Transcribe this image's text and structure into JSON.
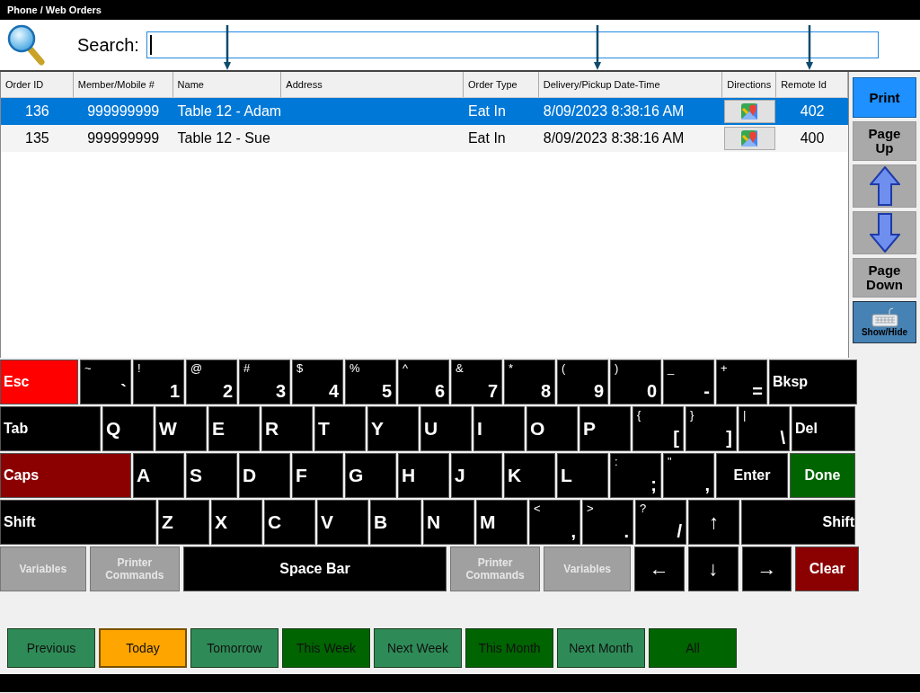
{
  "window": {
    "title": "Phone / Web Orders"
  },
  "search": {
    "label": "Search:"
  },
  "table": {
    "columns": [
      "Order ID",
      "Member/Mobile #",
      "Name",
      "Address",
      "Order Type",
      "Delivery/Pickup Date-Time",
      "Directions",
      "Remote Id"
    ],
    "rows": [
      {
        "selected": true,
        "order_id": "136",
        "member": "999999999",
        "name": "Table 12 - Adam",
        "order_type": "Eat In",
        "date_time": "8/09/2023 8:38:16 AM",
        "remote_id": "402"
      },
      {
        "selected": false,
        "order_id": "135",
        "member": "999999999",
        "name": "Table 12 - Sue",
        "order_type": "Eat In",
        "date_time": "8/09/2023 8:38:16 AM",
        "remote_id": "400"
      }
    ]
  },
  "side_panel": [
    {
      "kind": "primary",
      "label": "Print"
    },
    {
      "kind": "text",
      "label": "Page Up"
    },
    {
      "kind": "up"
    },
    {
      "kind": "down"
    },
    {
      "kind": "text",
      "label": "Page Down"
    },
    {
      "kind": "keyboard",
      "label": "Show/Hide"
    }
  ],
  "keyboard": [
    [
      {
        "kind": "label",
        "label": "Esc",
        "color": "#ff0000"
      },
      {
        "kind": "dual",
        "shift": "~",
        "base": "`"
      },
      {
        "kind": "dual",
        "shift": "!",
        "base": "1"
      },
      {
        "kind": "dual",
        "shift": "@",
        "base": "2"
      },
      {
        "kind": "dual",
        "shift": "#",
        "base": "3"
      },
      {
        "kind": "dual",
        "shift": "$",
        "base": "4"
      },
      {
        "kind": "dual",
        "shift": "%",
        "base": "5"
      },
      {
        "kind": "dual",
        "shift": "^",
        "base": "6"
      },
      {
        "kind": "dual",
        "shift": "&",
        "base": "7"
      },
      {
        "kind": "dual",
        "shift": "*",
        "base": "8"
      },
      {
        "kind": "dual",
        "shift": "(",
        "base": "9"
      },
      {
        "kind": "dual",
        "shift": ")",
        "base": "0"
      },
      {
        "kind": "dual",
        "shift": "_",
        "base": "-"
      },
      {
        "kind": "dual",
        "shift": "+",
        "base": "="
      },
      {
        "kind": "label",
        "label": "Bksp"
      }
    ],
    [
      {
        "kind": "label",
        "label": "Tab"
      },
      {
        "kind": "letter",
        "label": "Q"
      },
      {
        "kind": "letter",
        "label": "W"
      },
      {
        "kind": "letter",
        "label": "E"
      },
      {
        "kind": "letter",
        "label": "R"
      },
      {
        "kind": "letter",
        "label": "T"
      },
      {
        "kind": "letter",
        "label": "Y"
      },
      {
        "kind": "letter",
        "label": "U"
      },
      {
        "kind": "letter",
        "label": "I"
      },
      {
        "kind": "letter",
        "label": "O"
      },
      {
        "kind": "letter",
        "label": "P"
      },
      {
        "kind": "dual",
        "shift": "{",
        "base": "["
      },
      {
        "kind": "dual",
        "shift": "}",
        "base": "]"
      },
      {
        "kind": "dual",
        "shift": "|",
        "base": "\\"
      },
      {
        "kind": "label",
        "label": "Del"
      }
    ],
    [
      {
        "kind": "label",
        "label": "Caps",
        "color": "#8b0000"
      },
      {
        "kind": "letter",
        "label": "A"
      },
      {
        "kind": "letter",
        "label": "S"
      },
      {
        "kind": "letter",
        "label": "D"
      },
      {
        "kind": "letter",
        "label": "F"
      },
      {
        "kind": "letter",
        "label": "G"
      },
      {
        "kind": "letter",
        "label": "H"
      },
      {
        "kind": "letter",
        "label": "J"
      },
      {
        "kind": "letter",
        "label": "K"
      },
      {
        "kind": "letter",
        "label": "L"
      },
      {
        "kind": "dual",
        "shift": ":",
        "base": ";"
      },
      {
        "kind": "dual",
        "shift": "\"",
        "base": ","
      },
      {
        "kind": "center",
        "label": "Enter"
      },
      {
        "kind": "center",
        "label": "Done",
        "color": "#006400"
      }
    ],
    [
      {
        "kind": "label",
        "label": "Shift"
      },
      {
        "kind": "letter",
        "label": "Z"
      },
      {
        "kind": "letter",
        "label": "X"
      },
      {
        "kind": "letter",
        "label": "C"
      },
      {
        "kind": "letter",
        "label": "V"
      },
      {
        "kind": "letter",
        "label": "B"
      },
      {
        "kind": "letter",
        "label": "N"
      },
      {
        "kind": "letter",
        "label": "M"
      },
      {
        "kind": "dual",
        "shift": "<",
        "base": ","
      },
      {
        "kind": "dual",
        "shift": ">",
        "base": "."
      },
      {
        "kind": "dual",
        "shift": "?",
        "base": "/"
      },
      {
        "kind": "arrow",
        "label": "↑"
      },
      {
        "kind": "label-end",
        "label": "Shift"
      }
    ],
    [
      {
        "kind": "muted",
        "label": "Variables"
      },
      {
        "kind": "muted",
        "label": "Printer Commands"
      },
      {
        "kind": "center",
        "label": "Space Bar"
      },
      {
        "kind": "muted",
        "label": "Printer Commands"
      },
      {
        "kind": "muted",
        "label": "Variables"
      },
      {
        "kind": "arrow",
        "label": "←"
      },
      {
        "kind": "arrow",
        "label": "↓"
      },
      {
        "kind": "arrow",
        "label": "→"
      },
      {
        "kind": "center",
        "label": "Clear",
        "color": "#8b0000"
      }
    ]
  ],
  "date_filters": [
    {
      "label": "Previous",
      "selected": false,
      "color": "#2e8b57"
    },
    {
      "label": "Today",
      "selected": true,
      "color": "#ffa500"
    },
    {
      "label": "Tomorrow",
      "selected": false,
      "color": "#2e8b57"
    },
    {
      "label": "This Week",
      "selected": false,
      "color": "#006400"
    },
    {
      "label": "Next Week",
      "selected": false,
      "color": "#2e8b57"
    },
    {
      "label": "This Month",
      "selected": false,
      "color": "#006400"
    },
    {
      "label": "Next Month",
      "selected": false,
      "color": "#2e8b57"
    },
    {
      "label": "All",
      "selected": false,
      "color": "#006400"
    }
  ]
}
